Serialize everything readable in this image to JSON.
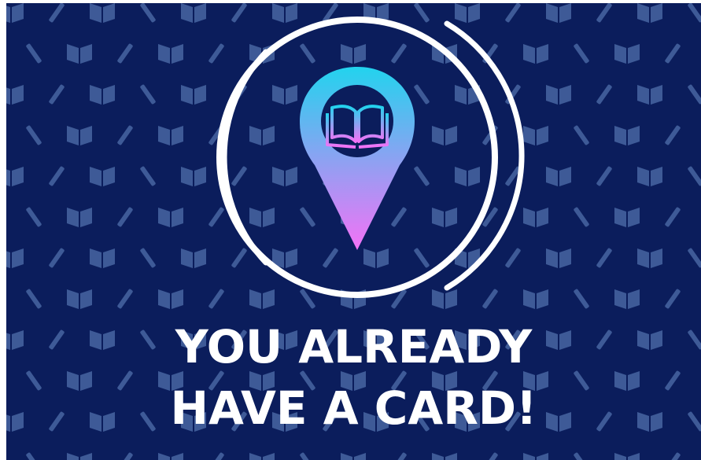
{
  "headline": {
    "line1": "YOU ALREADY",
    "line2": "HAVE A CARD!"
  },
  "icons": {
    "emblem": "location-pin-icon",
    "inner": "open-book-icon",
    "pattern": [
      "book-icon",
      "pencil-icon"
    ]
  },
  "colors": {
    "background": "#0b1d5c",
    "pattern": "#3e5a97",
    "ring": "#ffffff",
    "pin_top": "#22d3ee",
    "pin_bottom": "#f472f6",
    "text": "#ffffff"
  }
}
